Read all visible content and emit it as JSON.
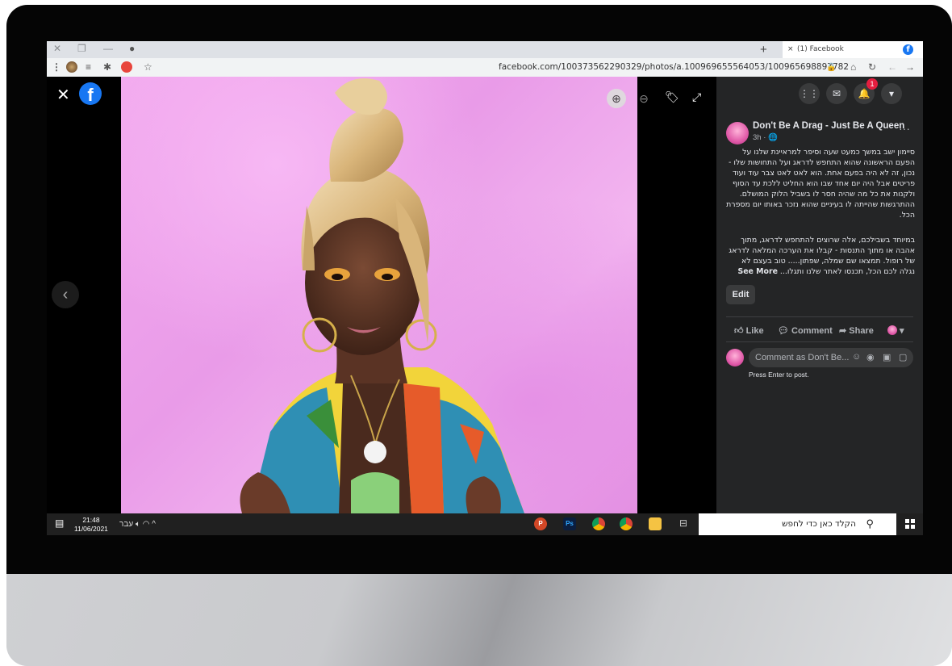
{
  "browser": {
    "tab_title": "(1) Facebook",
    "tab_close": "×",
    "new_tab": "+",
    "url": "facebook.com/100373562290329/photos/a.100969655564053/100965698897782"
  },
  "viewer": {
    "close_glyph": "✕",
    "logo_glyph": "f",
    "prev_glyph": "‹"
  },
  "sidebar": {
    "notifications_count": "1",
    "author": "Don't Be A Drag - Just Be A Queen",
    "time": "3h · 🌐",
    "more": "···",
    "post_paragraph_1": "סיימון ישב במשך כמעט שעה וסיפר למראיינת שלנו על הפעם הראשונה שהוא התחפש לדראג ועל התחושות שלו - נכון, זה לא היה בפעם אחת. הוא לאט לאט צבר עוד ועוד פריטים אבל היה יום אחד שבו הוא החליט ללכת עד הסוף ולקנות את כל מה שהיה חסר לו בשביל הלוק המושלם. ההתרגשות שהייתה לו בעיניים שהוא נזכר באותו יום מספרת הכל.",
    "post_paragraph_2": "במיוחד בשבילכם, אלה שרוצים להתחפש לדראג, מתוך אהבה או מתוך התנסות - קבלו את הערכה המלאה לדראג של רופול. תמצאו שם שמלה, שפתון..... טוב בעצם לא נגלה לכם הכל, תכנסו לאתר שלנו ותגלו...",
    "see_more": "See More",
    "edit_label": "Edit",
    "like_label": "Like",
    "comment_label": "Comment",
    "share_label": "Share",
    "comment_placeholder": "Comment as Don't Be...",
    "press_enter": "Press Enter to post."
  },
  "taskbar": {
    "time": "21:48",
    "date": "11/06/2021",
    "language": "עבר",
    "search_placeholder": "הקלד כאן כדי לחפש",
    "ps_label": "Ps"
  },
  "colors": {
    "facebook_blue": "#1877f2",
    "sidebar_bg": "#242526",
    "photo_pink": "#f2a9ee"
  }
}
